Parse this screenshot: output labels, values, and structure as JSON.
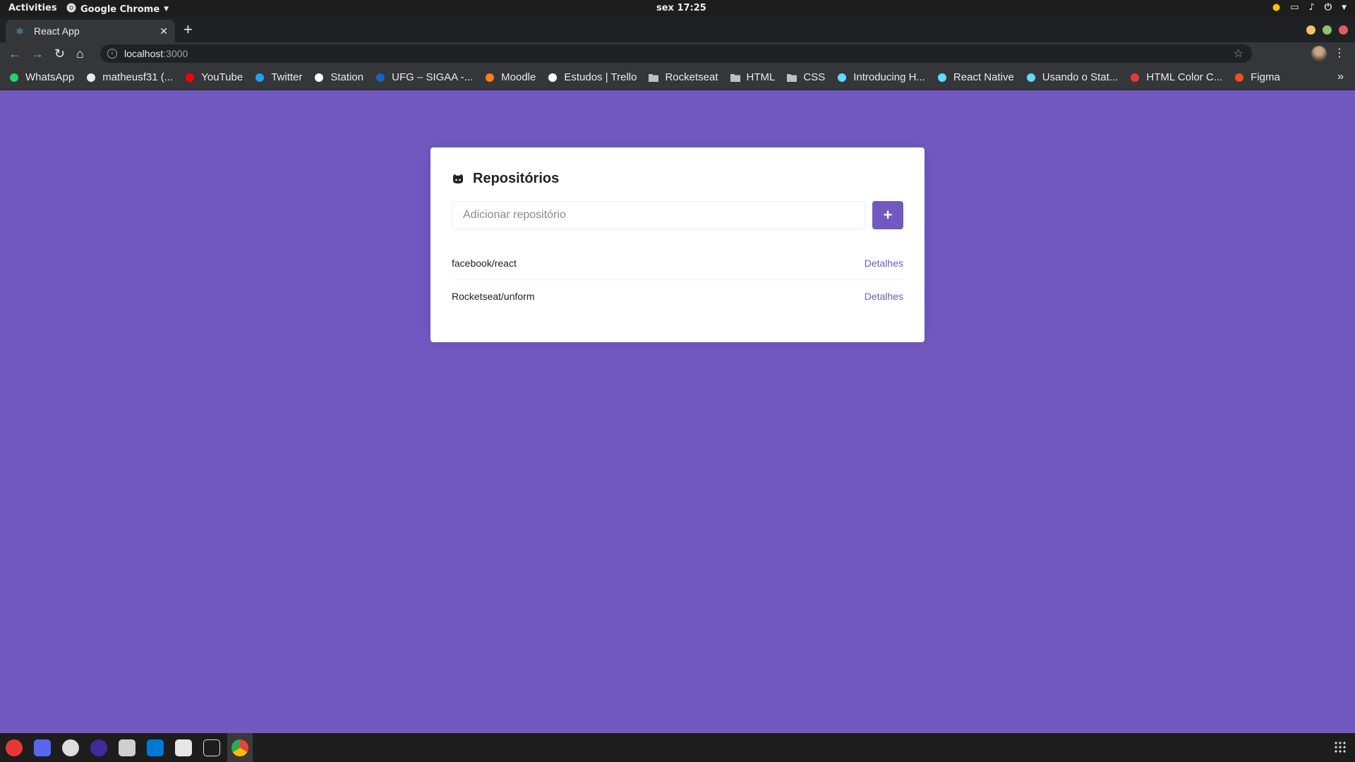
{
  "system_bar": {
    "activities": "Activities",
    "app_name": "Google Chrome",
    "clock": "sex 17:25"
  },
  "browser": {
    "tab_title": "React App",
    "url_host": "localhost",
    "url_port": ":3000",
    "bookmarks": [
      {
        "label": "WhatsApp",
        "icon": "whatsapp-icon",
        "color": "#25d366"
      },
      {
        "label": "matheusf31 (...",
        "icon": "github-icon",
        "color": "#e8eaed"
      },
      {
        "label": "YouTube",
        "icon": "youtube-icon",
        "color": "#ff0000"
      },
      {
        "label": "Twitter",
        "icon": "twitter-icon",
        "color": "#1da1f2"
      },
      {
        "label": "Station",
        "icon": "station-icon",
        "color": "#ffffff"
      },
      {
        "label": "UFG – SIGAA -...",
        "icon": "ufg-icon",
        "color": "#1565c0"
      },
      {
        "label": "Moodle",
        "icon": "moodle-icon",
        "color": "#f98012"
      },
      {
        "label": "Estudos | Trello",
        "icon": "trello-icon",
        "color": "#ffffff"
      },
      {
        "label": "Rocketseat",
        "icon": "folder-icon",
        "color": "#e8eaed"
      },
      {
        "label": "HTML",
        "icon": "folder-icon",
        "color": "#e8eaed"
      },
      {
        "label": "CSS",
        "icon": "folder-icon",
        "color": "#e8eaed"
      },
      {
        "label": "Introducing H...",
        "icon": "react-icon",
        "color": "#61dafb"
      },
      {
        "label": "React Native",
        "icon": "react-icon",
        "color": "#61dafb"
      },
      {
        "label": "Usando o Stat...",
        "icon": "react-icon",
        "color": "#61dafb"
      },
      {
        "label": "HTML Color C...",
        "icon": "htmlcolor-icon",
        "color": "#e53935"
      },
      {
        "label": "Figma",
        "icon": "figma-icon",
        "color": "#f24e1e"
      }
    ]
  },
  "page": {
    "title": "Repositórios",
    "input_placeholder": "Adicionar repositório",
    "add_button_label": "+",
    "repositories": [
      {
        "name": "facebook/react",
        "link": "Detalhes"
      },
      {
        "name": "Rocketseat/unform",
        "link": "Detalhes"
      }
    ]
  },
  "colors": {
    "background": "#7159c1",
    "accent": "#7159c1",
    "card": "#ffffff"
  }
}
